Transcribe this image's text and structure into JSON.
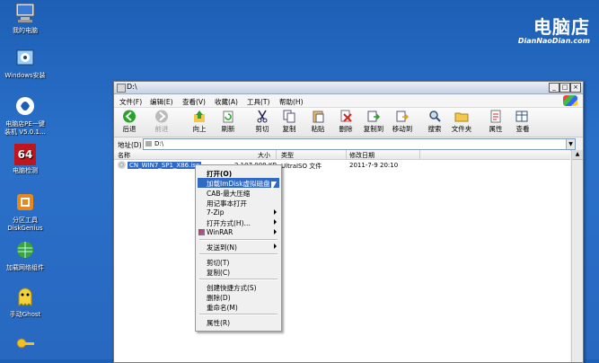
{
  "desktop": {
    "icons": [
      {
        "label_lines": [
          "我的电脑"
        ]
      },
      {
        "label_lines": [
          "Windows安装"
        ]
      },
      {
        "label_lines": [
          "电脑店PE一键",
          "装机 V5.0.1…"
        ]
      },
      {
        "label_lines": [
          "电脑检测"
        ]
      },
      {
        "label_lines": [
          "分区工具",
          "DiskGenius"
        ]
      },
      {
        "label_lines": [
          "加载网络组件"
        ]
      },
      {
        "label_lines": [
          "手动Ghost"
        ]
      }
    ],
    "watermark": {
      "title": "电脑店",
      "subtitle": "DianNaoDian.com"
    }
  },
  "window": {
    "title": "D:\\",
    "menu": [
      "文件(F)",
      "编辑(E)",
      "查看(V)",
      "收藏(A)",
      "工具(T)",
      "帮助(H)"
    ],
    "toolbar": [
      {
        "label": "后退",
        "icon": "back-icon",
        "enabled": true
      },
      {
        "label": "前进",
        "icon": "forward-icon",
        "enabled": false
      },
      {
        "label": "向上",
        "icon": "up-icon",
        "enabled": true
      },
      {
        "label": "刷新",
        "icon": "refresh-icon",
        "enabled": true
      },
      {
        "label": "剪切",
        "icon": "cut-icon",
        "enabled": true
      },
      {
        "label": "复制",
        "icon": "copy-icon",
        "enabled": true
      },
      {
        "label": "粘贴",
        "icon": "paste-icon",
        "enabled": true
      },
      {
        "label": "删除",
        "icon": "delete-icon",
        "enabled": true
      },
      {
        "label": "复制到",
        "icon": "copy-to-icon",
        "enabled": true
      },
      {
        "label": "移动到",
        "icon": "move-to-icon",
        "enabled": true
      },
      {
        "label": "搜索",
        "icon": "search-icon",
        "enabled": true
      },
      {
        "label": "文件夹",
        "icon": "folders-icon",
        "enabled": true
      },
      {
        "label": "属性",
        "icon": "properties-icon",
        "enabled": true
      },
      {
        "label": "查看",
        "icon": "view-icon",
        "enabled": true
      }
    ],
    "address": {
      "label": "地址(D)",
      "value": "D:\\"
    },
    "columns": [
      "名称",
      "大小",
      "类型",
      "修改日期"
    ],
    "files": [
      {
        "name": "CN_WIN7_SP1_X86.iso",
        "size": "2,107,008 KB",
        "type": "UltraISO 文件",
        "modified": "2011-7-9 20:10"
      }
    ]
  },
  "context_menu": {
    "items": [
      {
        "label": "打开(O)",
        "bold": true
      },
      {
        "label": "加载ImDisk虚拟磁盘",
        "highlight": true
      },
      {
        "label": "CAB-最大压缩"
      },
      {
        "label": "用记事本打开"
      },
      {
        "label": "7-Zip",
        "submenu": true
      },
      {
        "label": "打开方式(H)…",
        "submenu": true
      },
      {
        "label": "WinRAR",
        "submenu": true,
        "icon": "winrar-icon"
      },
      {
        "separator": true
      },
      {
        "label": "发送到(N)",
        "submenu": true
      },
      {
        "separator": true
      },
      {
        "label": "剪切(T)"
      },
      {
        "label": "复制(C)"
      },
      {
        "separator": true
      },
      {
        "label": "创建快捷方式(S)"
      },
      {
        "label": "删除(D)"
      },
      {
        "label": "重命名(M)"
      },
      {
        "separator": true
      },
      {
        "label": "属性(R)"
      }
    ],
    "highlight_color": "#316ac5"
  }
}
